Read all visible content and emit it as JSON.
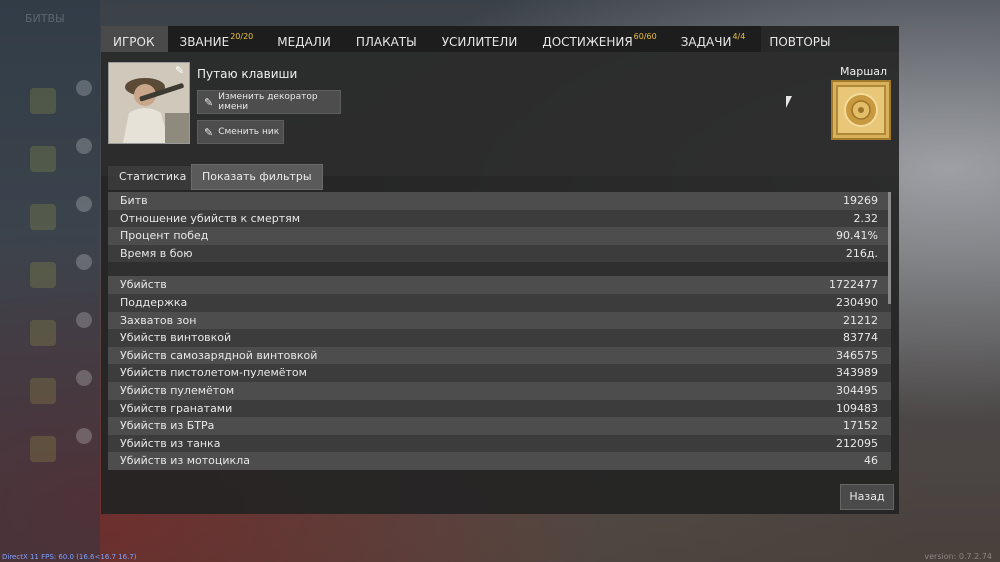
{
  "background": {
    "top_label": "БИТВЫ",
    "fps_text": "DirectX 11 FPS: 60.0 (16.6<16.7 16.7)",
    "version_text": "version: 0.7.2.74"
  },
  "tabs": [
    {
      "label": "ИГРОК",
      "badge": "",
      "active": true
    },
    {
      "label": "ЗВАНИЕ",
      "badge": "20/20",
      "active": false
    },
    {
      "label": "МЕДАЛИ",
      "badge": "",
      "active": false
    },
    {
      "label": "ПЛАКАТЫ",
      "badge": "",
      "active": false
    },
    {
      "label": "УСИЛИТЕЛИ",
      "badge": "",
      "active": false
    },
    {
      "label": "ДОСТИЖЕНИЯ",
      "badge": "60/60",
      "active": false
    },
    {
      "label": "ЗАДАЧИ",
      "badge": "4/4",
      "active": false
    },
    {
      "label": "ПОВТОРЫ",
      "badge": "",
      "active": false
    }
  ],
  "profile": {
    "player_name": "Путаю клавиши",
    "decorator_button": "Изменить декоратор имени",
    "nick_button": "Сменить ник",
    "rank_name": "Маршал"
  },
  "stats_panel": {
    "tab_label": "Статистика",
    "filters_button": "Показать фильтры",
    "group1": [
      {
        "label": "Битв",
        "value": "19269"
      },
      {
        "label": "Отношение убийств к смертям",
        "value": "2.32"
      },
      {
        "label": "Процент побед",
        "value": "90.41%"
      },
      {
        "label": "Время в бою",
        "value": "216д."
      }
    ],
    "group2": [
      {
        "label": "Убийств",
        "value": "1722477"
      },
      {
        "label": "Поддержка",
        "value": "230490"
      },
      {
        "label": "Захватов зон",
        "value": "21212"
      },
      {
        "label": "Убийств винтовкой",
        "value": "83774"
      },
      {
        "label": "Убийств самозарядной винтовкой",
        "value": "346575"
      },
      {
        "label": "Убийств пистолетом-пулемётом",
        "value": "343989"
      },
      {
        "label": "Убийств пулемётом",
        "value": "304495"
      },
      {
        "label": "Убийств гранатами",
        "value": "109483"
      },
      {
        "label": "Убийств из БТРа",
        "value": "17152"
      },
      {
        "label": "Убийств из танка",
        "value": "212095"
      },
      {
        "label": "Убийств из мотоцикла",
        "value": "46"
      }
    ]
  },
  "back_button": "Назад",
  "colors": {
    "badge": "#e8c040",
    "rank_gold": "#d9b15a"
  }
}
